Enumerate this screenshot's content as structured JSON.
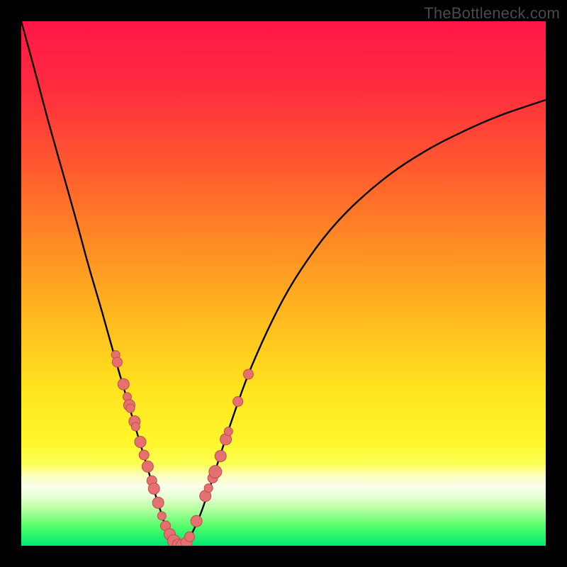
{
  "watermark": "TheBottleneck.com",
  "colors": {
    "frame": "#000000",
    "curve": "#000000",
    "dot_fill": "#e47070",
    "dot_stroke": "#be4d4d",
    "gradient_stops": [
      {
        "offset": 0.0,
        "color": "#ff1747"
      },
      {
        "offset": 0.12,
        "color": "#ff2a3f"
      },
      {
        "offset": 0.28,
        "color": "#ff5a2e"
      },
      {
        "offset": 0.42,
        "color": "#ff8a24"
      },
      {
        "offset": 0.56,
        "color": "#ffb81e"
      },
      {
        "offset": 0.7,
        "color": "#ffe41e"
      },
      {
        "offset": 0.8,
        "color": "#fff62a"
      },
      {
        "offset": 0.845,
        "color": "#fcff55"
      },
      {
        "offset": 0.865,
        "color": "#fbffba"
      },
      {
        "offset": 0.888,
        "color": "#fafeef"
      },
      {
        "offset": 0.905,
        "color": "#e9ffd8"
      },
      {
        "offset": 0.93,
        "color": "#b6ffa0"
      },
      {
        "offset": 0.965,
        "color": "#4dfd68"
      },
      {
        "offset": 1.0,
        "color": "#00e874"
      }
    ]
  },
  "chart_data": {
    "type": "line",
    "title": "",
    "xlabel": "",
    "ylabel": "",
    "xlim": [
      0,
      1
    ],
    "ylim": [
      0,
      1
    ],
    "series": [
      {
        "name": "bottleneck-curve",
        "x": [
          0.0,
          0.026,
          0.051,
          0.077,
          0.103,
          0.128,
          0.154,
          0.179,
          0.205,
          0.231,
          0.25,
          0.258,
          0.266,
          0.273,
          0.281,
          0.289,
          0.297,
          0.305,
          0.312,
          0.32,
          0.34,
          0.36,
          0.4,
          0.44,
          0.5,
          0.56,
          0.62,
          0.7,
          0.78,
          0.86,
          0.92,
          1.0
        ],
        "y": [
          1.0,
          0.905,
          0.811,
          0.719,
          0.627,
          0.535,
          0.446,
          0.357,
          0.268,
          0.181,
          0.117,
          0.09,
          0.065,
          0.043,
          0.024,
          0.011,
          0.003,
          0.0,
          0.003,
          0.013,
          0.056,
          0.113,
          0.235,
          0.344,
          0.471,
          0.565,
          0.636,
          0.706,
          0.758,
          0.798,
          0.823,
          0.85
        ]
      }
    ],
    "scatter": [
      {
        "x": 0.18,
        "y": 0.364,
        "r": 6
      },
      {
        "x": 0.183,
        "y": 0.35,
        "r": 7
      },
      {
        "x": 0.195,
        "y": 0.308,
        "r": 8
      },
      {
        "x": 0.202,
        "y": 0.284,
        "r": 6
      },
      {
        "x": 0.206,
        "y": 0.268,
        "r": 8
      },
      {
        "x": 0.208,
        "y": 0.262,
        "r": 6
      },
      {
        "x": 0.216,
        "y": 0.237,
        "r": 8
      },
      {
        "x": 0.218,
        "y": 0.227,
        "r": 6
      },
      {
        "x": 0.227,
        "y": 0.198,
        "r": 8
      },
      {
        "x": 0.234,
        "y": 0.173,
        "r": 7
      },
      {
        "x": 0.241,
        "y": 0.151,
        "r": 8
      },
      {
        "x": 0.249,
        "y": 0.124,
        "r": 7
      },
      {
        "x": 0.253,
        "y": 0.109,
        "r": 8
      },
      {
        "x": 0.261,
        "y": 0.082,
        "r": 8
      },
      {
        "x": 0.268,
        "y": 0.057,
        "r": 6
      },
      {
        "x": 0.275,
        "y": 0.038,
        "r": 7
      },
      {
        "x": 0.283,
        "y": 0.022,
        "r": 8
      },
      {
        "x": 0.291,
        "y": 0.009,
        "r": 9
      },
      {
        "x": 0.299,
        "y": 0.002,
        "r": 8
      },
      {
        "x": 0.307,
        "y": 0.0,
        "r": 9
      },
      {
        "x": 0.315,
        "y": 0.006,
        "r": 8
      },
      {
        "x": 0.321,
        "y": 0.017,
        "r": 7
      },
      {
        "x": 0.334,
        "y": 0.047,
        "r": 8
      },
      {
        "x": 0.351,
        "y": 0.095,
        "r": 8
      },
      {
        "x": 0.357,
        "y": 0.11,
        "r": 6
      },
      {
        "x": 0.365,
        "y": 0.129,
        "r": 7
      },
      {
        "x": 0.37,
        "y": 0.141,
        "r": 9
      },
      {
        "x": 0.38,
        "y": 0.171,
        "r": 8
      },
      {
        "x": 0.39,
        "y": 0.203,
        "r": 8
      },
      {
        "x": 0.395,
        "y": 0.218,
        "r": 6
      },
      {
        "x": 0.413,
        "y": 0.275,
        "r": 7
      },
      {
        "x": 0.433,
        "y": 0.327,
        "r": 7
      }
    ]
  }
}
